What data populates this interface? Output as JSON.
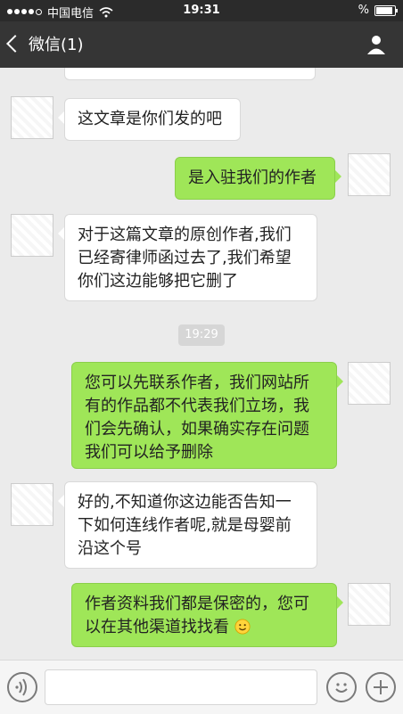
{
  "status_bar": {
    "carrier": "中国电信",
    "time": "19:31",
    "battery_text": "%",
    "battery_level": 0.9
  },
  "nav": {
    "back_label": "微信(1)"
  },
  "messages": [
    {
      "side": "left",
      "text": "这文章是你们发的吧"
    },
    {
      "side": "right",
      "text": "是入驻我们的作者"
    },
    {
      "side": "left",
      "lines": [
        "对于这篇文章的原创作者,我们",
        "已经寄律师函过去了,我们希望",
        "你们这边能够把它删了"
      ]
    },
    {
      "side": "right",
      "lines": [
        "您可以先联系作者，我们网站所",
        "有的作品都不代表我们立场，我",
        "们会先确认，如果确实存在问题",
        "我们可以给予删除"
      ]
    },
    {
      "side": "left",
      "lines": [
        "好的,不知道你这边能否告知一",
        "下如何连线作者呢,就是母婴前",
        "沿这个号"
      ]
    },
    {
      "side": "right",
      "lines": [
        "作者资料我们都是保密的，您可",
        "以在其他渠道找找看"
      ],
      "emoji": "smile-emoji"
    }
  ],
  "timestamp": "19:29",
  "icons": [
    "back-chevron-icon",
    "profile-icon",
    "voice-icon",
    "emoji-icon",
    "plus-icon",
    "wifi-icon",
    "battery-icon"
  ]
}
